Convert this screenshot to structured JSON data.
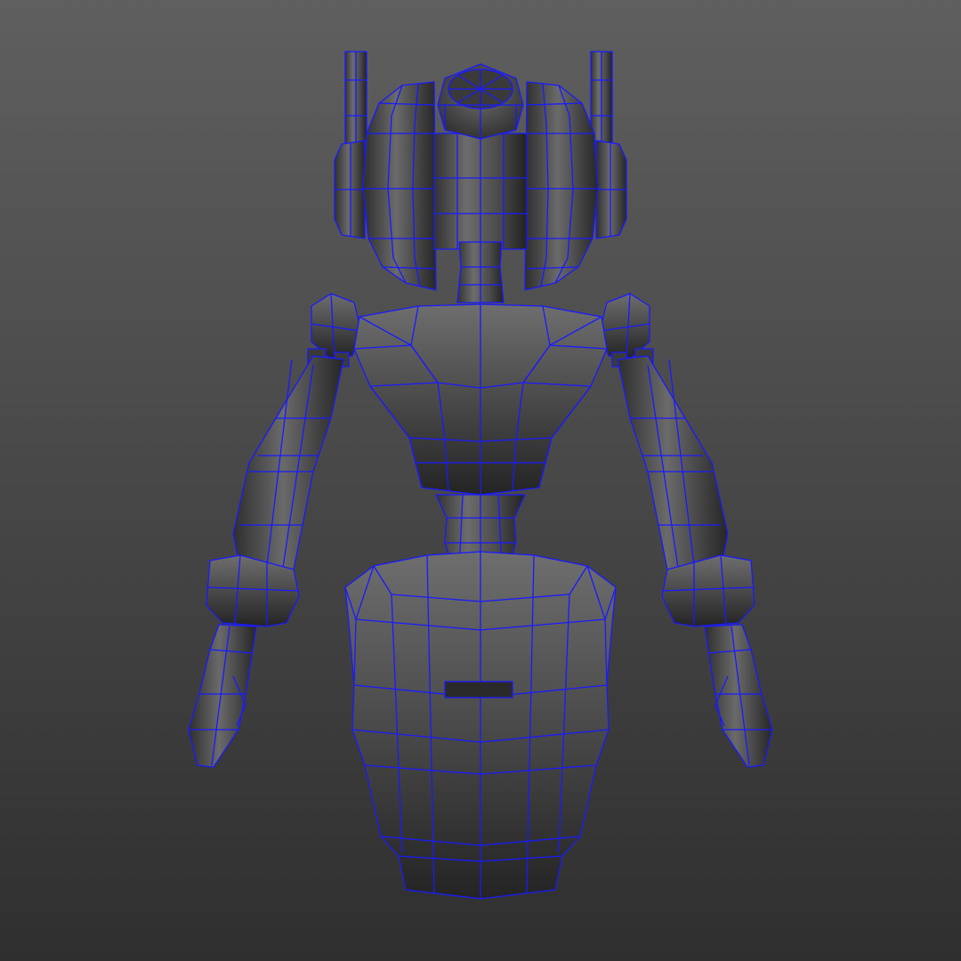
{
  "viewport": {
    "background_top": "#5f5f5f",
    "background_bottom": "#2f2f2f"
  },
  "model": {
    "wireframe_color": "#1a1aff",
    "shade_light": "#6a6a6a",
    "shade_mid": "#484848",
    "shade_dark": "#262626",
    "parts": [
      "antenna-left",
      "antenna-right",
      "ear-left",
      "ear-right",
      "head-core",
      "head-cap",
      "neck",
      "torso",
      "shoulder-left",
      "shoulder-right",
      "arm-left",
      "arm-right",
      "hand-left",
      "hand-right",
      "waist",
      "pot-base"
    ]
  }
}
